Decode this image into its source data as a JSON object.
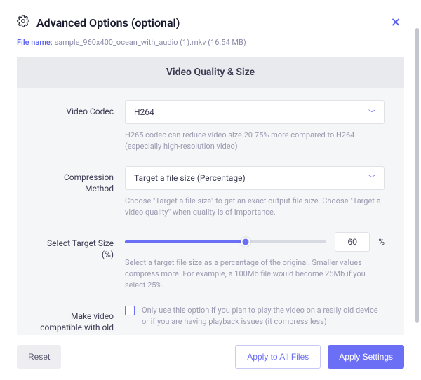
{
  "header": {
    "title": "Advanced Options (optional)"
  },
  "file": {
    "label": "File name: ",
    "value": "sample_960x400_ocean_with_audio (1).mkv (16.54 MB)"
  },
  "card": {
    "title": "Video Quality & Size"
  },
  "codec": {
    "label": "Video Codec",
    "value": "H264",
    "help": "H265 codec can reduce video size 20-75% more compared to H264 (especially high-resolution video)"
  },
  "method": {
    "label": "Compression Method",
    "value": "Target a file size (Percentage)",
    "help": "Choose \"Target a file size\" to get an exact output file size. Choose \"Target a video quality\" when quality is of importance."
  },
  "target": {
    "label": "Select Target Size (%)",
    "value": "60",
    "percent_symbol": "%",
    "slider_percent": 60,
    "help": "Select a target file size as a percentage of the original. Smaller values compress more. For example, a 100Mb file would become 25Mb if you select 25%."
  },
  "compat": {
    "label": "Make video compatible with old devices?",
    "checked": false,
    "help": "Only use this option if you plan to play the video on a really old device or if you are having playback issues (it compress less)"
  },
  "buttons": {
    "reset": "Reset",
    "apply_all": "Apply to All Files",
    "apply": "Apply Settings"
  }
}
